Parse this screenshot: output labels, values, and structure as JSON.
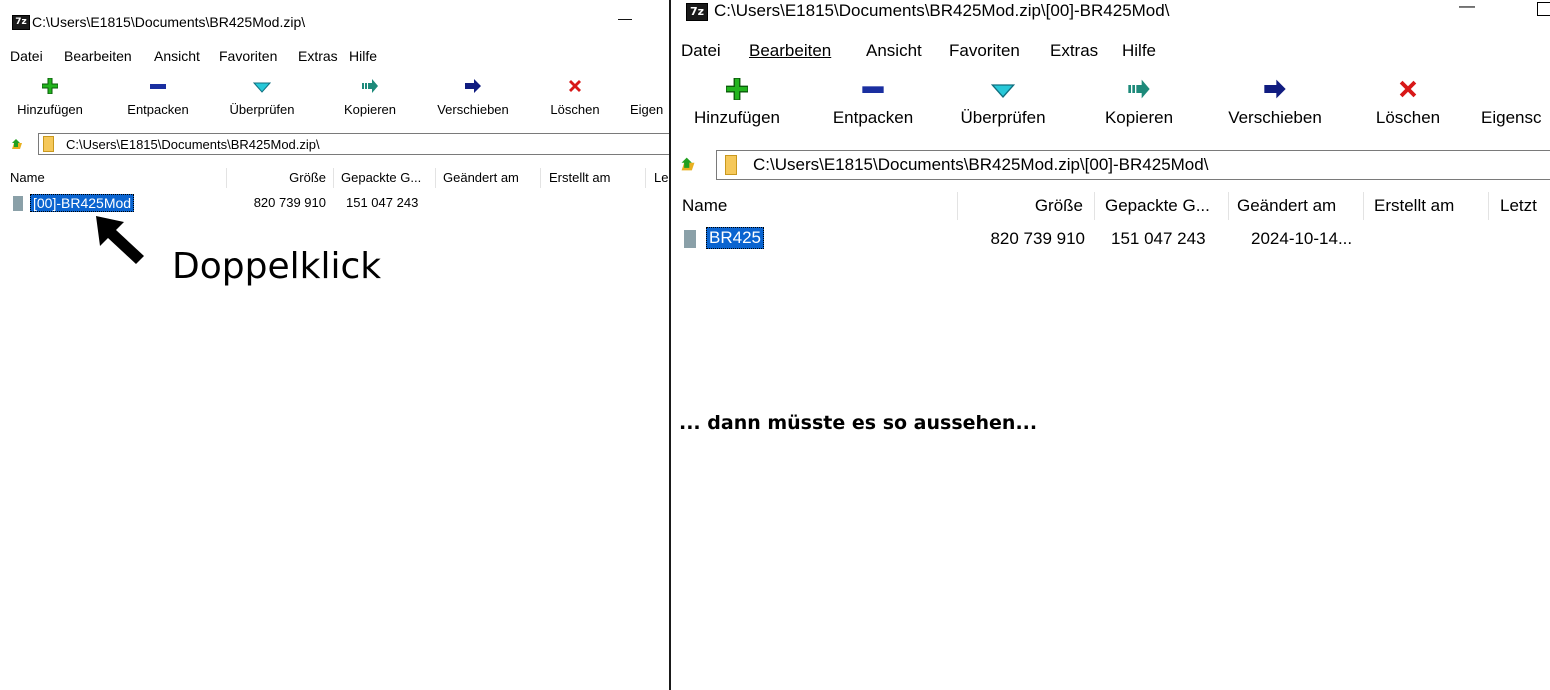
{
  "window_left": {
    "title": "C:\\Users\\E1815\\Documents\\BR425Mod.zip\\",
    "app_icon_label": "7z",
    "minimize_glyph": "—",
    "menu": [
      "Datei",
      "Bearbeiten",
      "Ansicht",
      "Favoriten",
      "Extras",
      "Hilfe"
    ],
    "toolbar": [
      "Hinzufügen",
      "Entpacken",
      "Überprüfen",
      "Kopieren",
      "Verschieben",
      "Löschen",
      "Eigen"
    ],
    "address": "C:\\Users\\E1815\\Documents\\BR425Mod.zip\\",
    "columns": [
      "Name",
      "Größe",
      "Gepackte G...",
      "Geändert am",
      "Erstellt am",
      "Le"
    ],
    "rows": [
      {
        "name": "[00]-BR425Mod",
        "size": "820 739 910",
        "packed": "151 047 243",
        "modified": "",
        "created": ""
      }
    ]
  },
  "window_right": {
    "title": "C:\\Users\\E1815\\Documents\\BR425Mod.zip\\[00]-BR425Mod\\",
    "app_icon_label": "7z",
    "minimize_glyph": "—",
    "menu": [
      "Datei",
      "Bearbeiten",
      "Ansicht",
      "Favoriten",
      "Extras",
      "Hilfe"
    ],
    "menu_underlined": [
      "",
      "B",
      "A",
      "F",
      "E",
      "H"
    ],
    "toolbar": [
      "Hinzufügen",
      "Entpacken",
      "Überprüfen",
      "Kopieren",
      "Verschieben",
      "Löschen",
      "Eigensc"
    ],
    "address": "C:\\Users\\E1815\\Documents\\BR425Mod.zip\\[00]-BR425Mod\\",
    "columns": [
      "Name",
      "Größe",
      "Gepackte G...",
      "Geändert am",
      "Erstellt am",
      "Letzt"
    ],
    "rows": [
      {
        "name": "BR425",
        "size": "820 739 910",
        "packed": "151 047 243",
        "modified": "2024-10-14...",
        "created": ""
      }
    ]
  },
  "annotations": {
    "double_click": "Doppelklick",
    "result_note": "... dann müsste es so aussehen..."
  },
  "colors": {
    "selection": "#0a64d0",
    "add": "#22b41e",
    "extract": "#1a2fa0",
    "test": "#28c8d8",
    "copy": "#1d8a7a",
    "move": "#101c80",
    "delete": "#d81818",
    "info": "#e8c400"
  }
}
